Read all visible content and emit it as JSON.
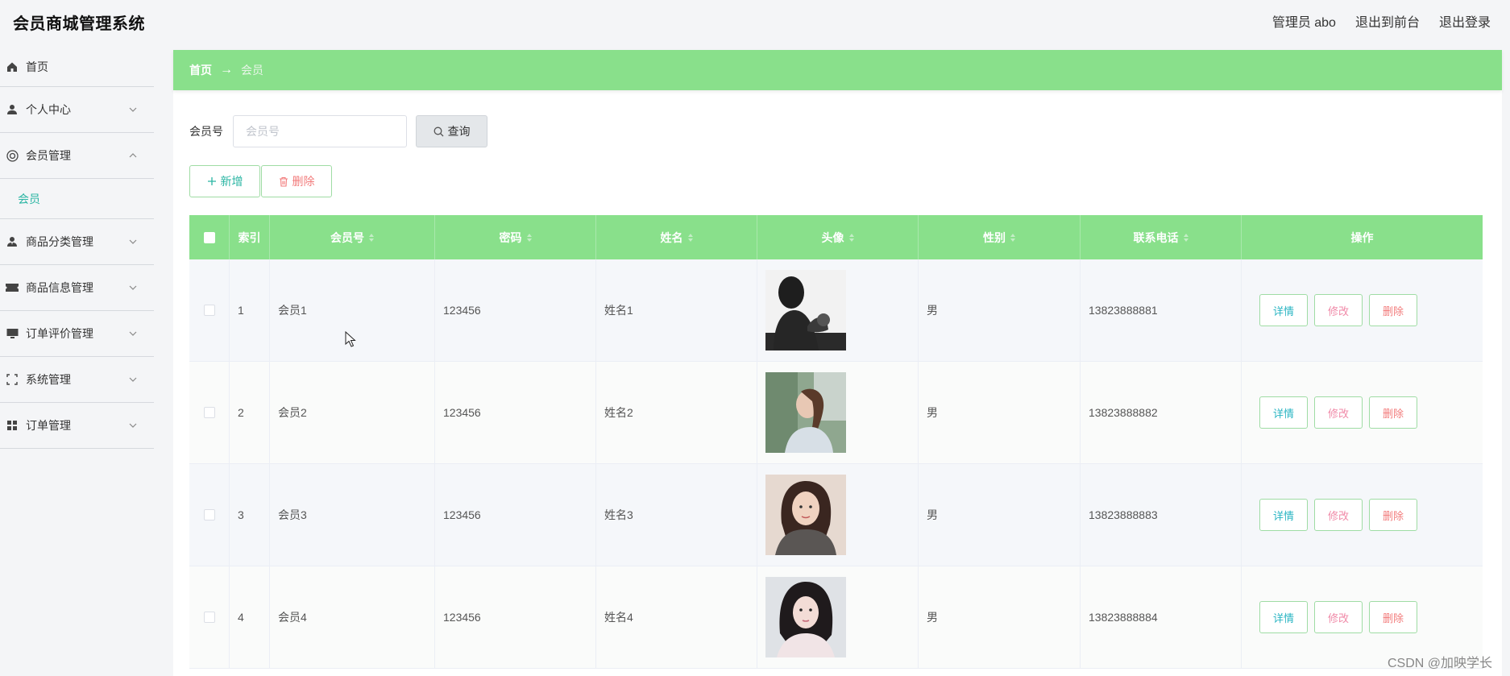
{
  "header": {
    "app_title": "会员商城管理系统",
    "admin_label": "管理员 abo",
    "to_front": "退出到前台",
    "logout": "退出登录"
  },
  "sidebar": {
    "items": [
      {
        "label": "首页",
        "icon": "home-icon"
      },
      {
        "label": "个人中心",
        "icon": "user-icon"
      },
      {
        "label": "会员管理",
        "icon": "lifebuoy-icon"
      },
      {
        "label": "商品分类管理",
        "icon": "user-tie-icon"
      },
      {
        "label": "商品信息管理",
        "icon": "ticket-icon"
      },
      {
        "label": "订单评价管理",
        "icon": "monitor-icon"
      },
      {
        "label": "系统管理",
        "icon": "fullscreen-icon"
      },
      {
        "label": "订单管理",
        "icon": "grid-icon"
      }
    ],
    "sub_item": "会员",
    "accent": "#2ab5a3"
  },
  "breadcrumb": {
    "home": "首页",
    "arrow": "→",
    "current": "会员"
  },
  "search": {
    "label": "会员号",
    "placeholder": "会员号",
    "query_label": "查询"
  },
  "actions": {
    "add_label": "新增",
    "delete_label": "删除"
  },
  "table": {
    "header_color": "#89e08b",
    "columns": [
      "索引",
      "会员号",
      "密码",
      "姓名",
      "头像",
      "性别",
      "联系电话",
      "操作"
    ],
    "rows": [
      {
        "index": "1",
        "member_no": "会员1",
        "password": "123456",
        "name": "姓名1",
        "gender": "男",
        "phone": "13823888881"
      },
      {
        "index": "2",
        "member_no": "会员2",
        "password": "123456",
        "name": "姓名2",
        "gender": "男",
        "phone": "13823888882"
      },
      {
        "index": "3",
        "member_no": "会员3",
        "password": "123456",
        "name": "姓名3",
        "gender": "男",
        "phone": "13823888883"
      },
      {
        "index": "4",
        "member_no": "会员4",
        "password": "123456",
        "name": "姓名4",
        "gender": "男",
        "phone": "13823888884"
      }
    ],
    "ops": {
      "detail": "详情",
      "edit": "修改",
      "remove": "删除"
    }
  },
  "watermark": "CSDN @加映学长"
}
